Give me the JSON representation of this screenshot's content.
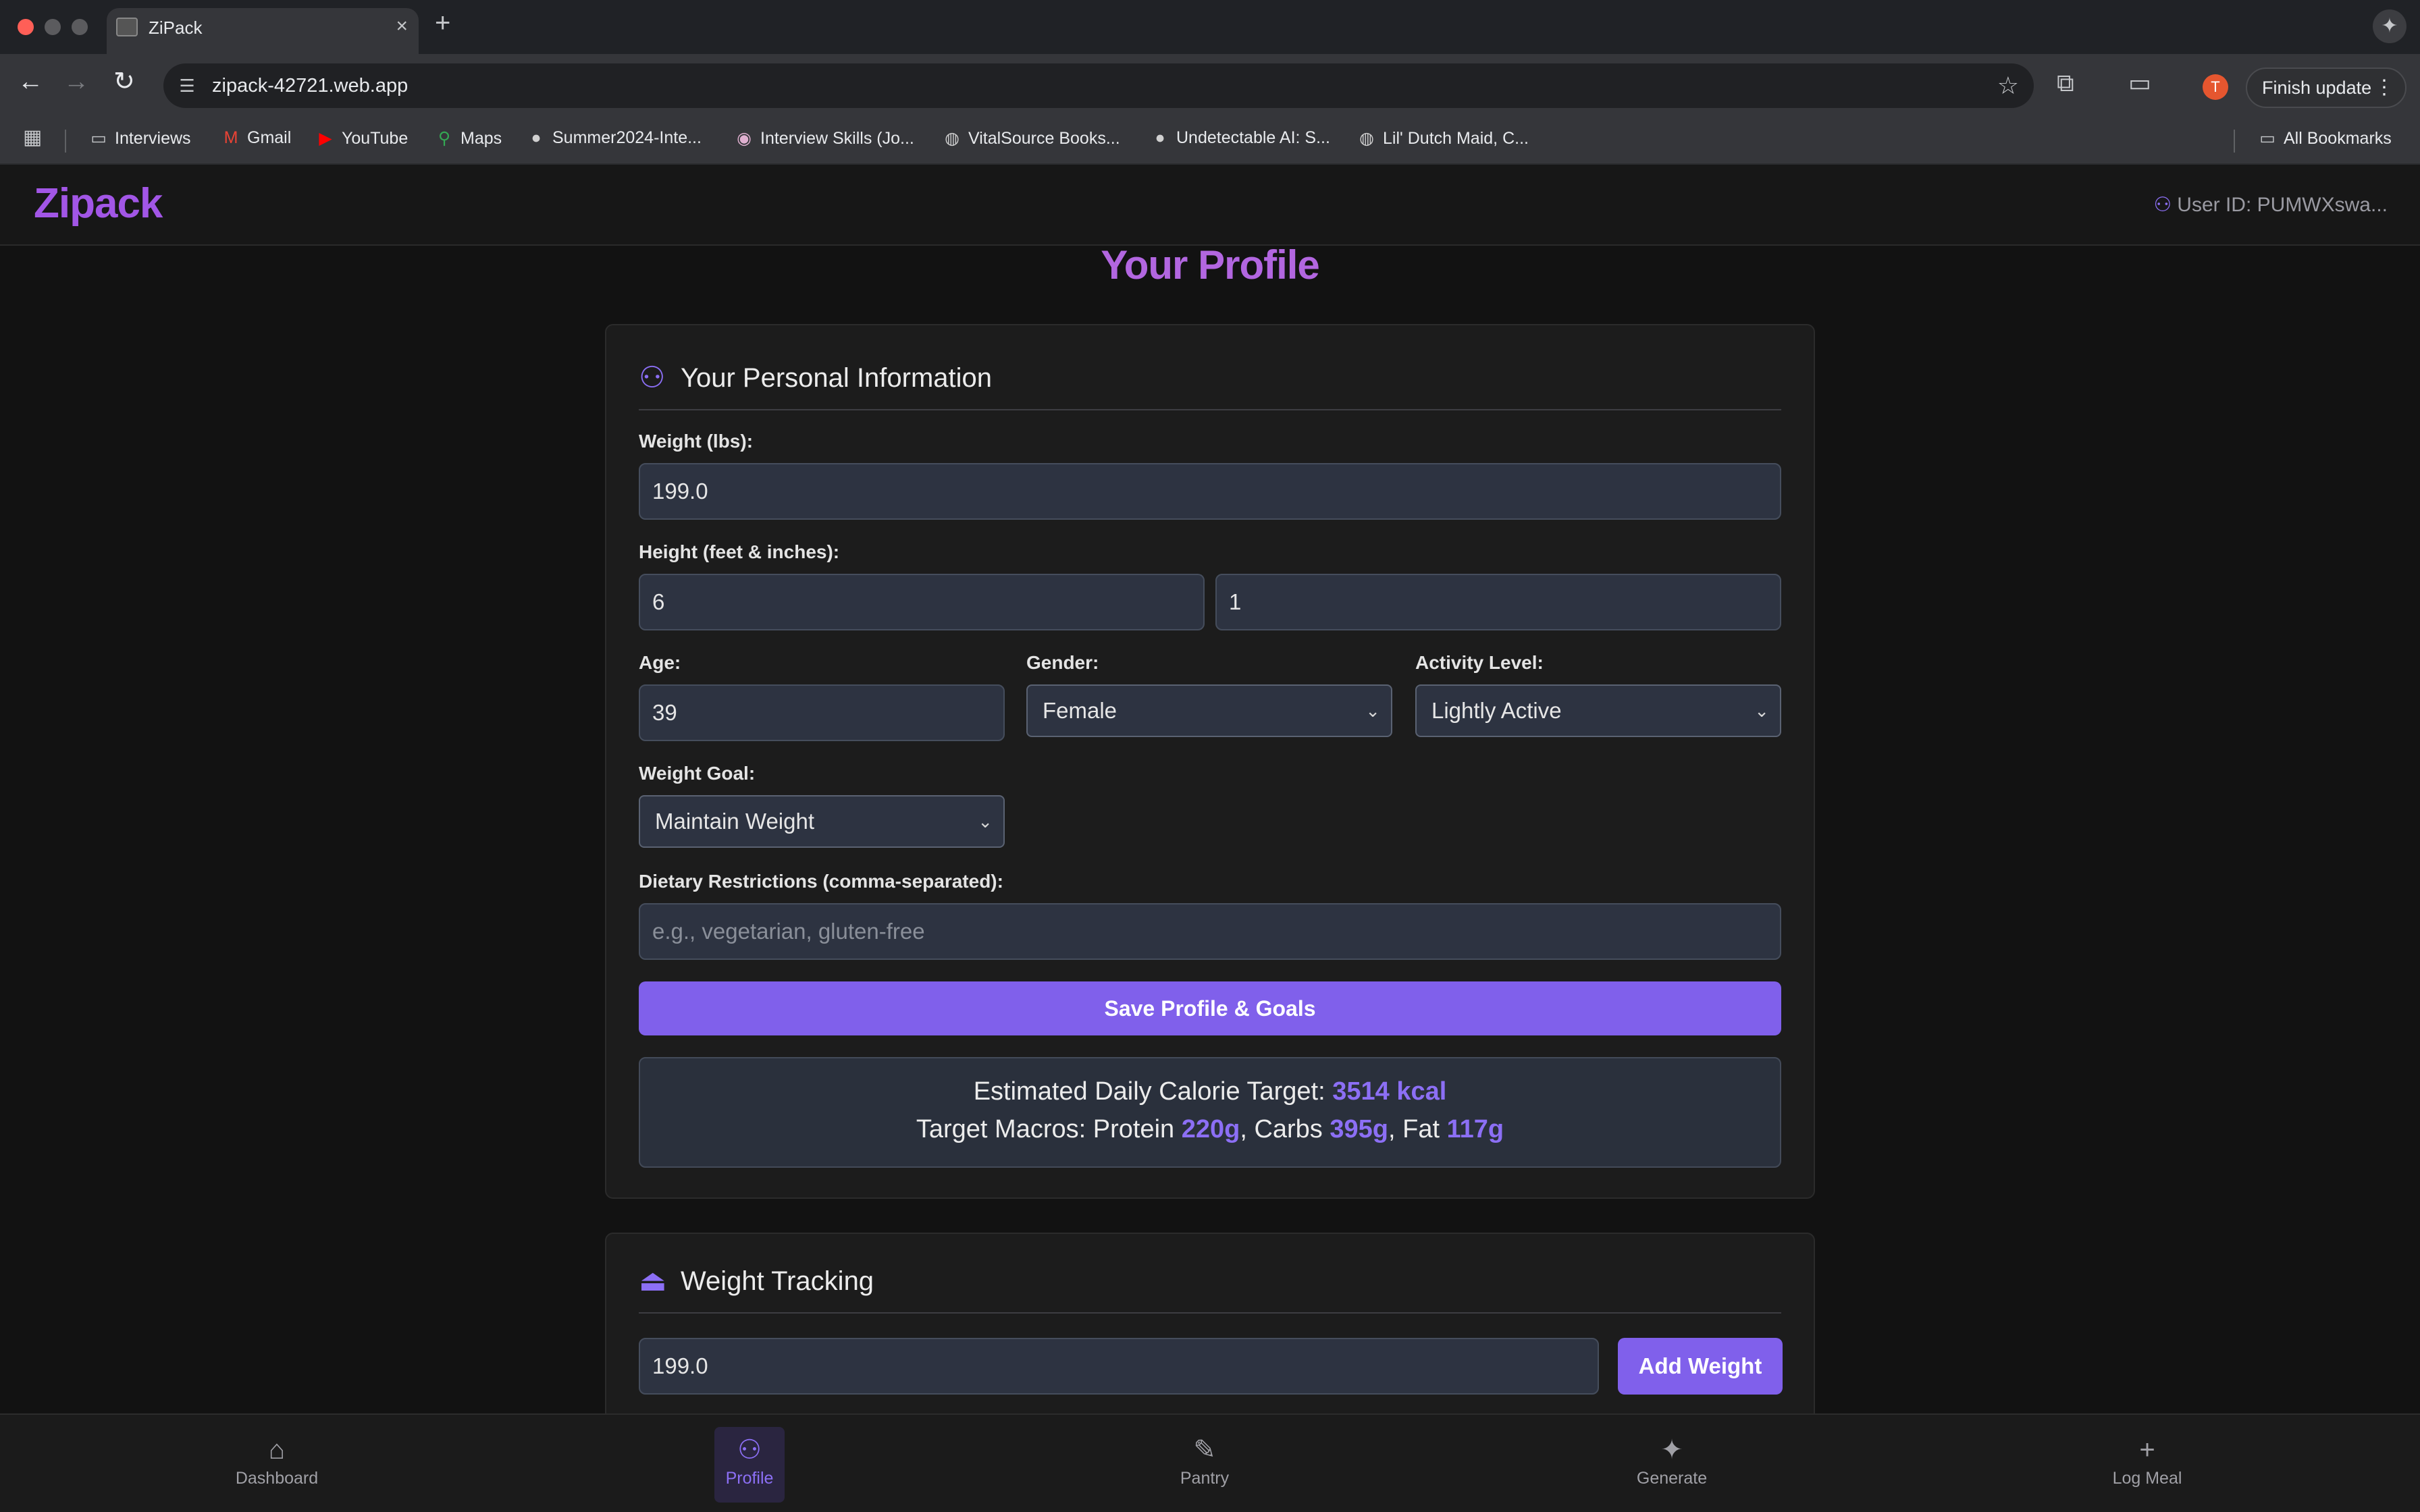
{
  "browser": {
    "tab_title": "ZiPack",
    "tab_close": "×",
    "new_tab": "+",
    "url": "zipack-42721.web.app",
    "avatar_letter": "T",
    "finish_update": "Finish update",
    "bookmarks": [
      {
        "label": "Interviews",
        "icon": "folder-icon"
      },
      {
        "label": "Gmail",
        "icon": "gmail-icon"
      },
      {
        "label": "YouTube",
        "icon": "youtube-icon"
      },
      {
        "label": "Maps",
        "icon": "maps-icon"
      },
      {
        "label": "Summer2024-Inte...",
        "icon": "github-icon"
      },
      {
        "label": "Interview Skills (Jo...",
        "icon": "site-icon"
      },
      {
        "label": "VitalSource Books...",
        "icon": "globe-icon"
      },
      {
        "label": "Undetectable AI: S...",
        "icon": "site-icon"
      },
      {
        "label": "Lil' Dutch Maid, C...",
        "icon": "globe-icon"
      }
    ],
    "all_bookmarks": "All Bookmarks"
  },
  "header": {
    "brand": "Zipack",
    "user_id": "User ID: PUMWXswa..."
  },
  "page_title": "Your Profile",
  "personal": {
    "title": "Your Personal Information",
    "weight_label": "Weight (lbs):",
    "weight_value": "199.0",
    "height_label": "Height (feet & inches):",
    "height_feet": "6",
    "height_inches": "1",
    "age_label": "Age:",
    "age_value": "39",
    "gender_label": "Gender:",
    "gender_value": "Female",
    "activity_label": "Activity Level:",
    "activity_value": "Lightly Active",
    "goal_label": "Weight Goal:",
    "goal_value": "Maintain Weight",
    "dietary_label": "Dietary Restrictions (comma-separated):",
    "dietary_placeholder": "e.g., vegetarian, gluten-free",
    "save_label": "Save Profile & Goals"
  },
  "summary": {
    "calorie_prefix": "Estimated Daily Calorie Target: ",
    "calorie_value": "3514 kcal",
    "macros_prefix": "Target Macros: Protein ",
    "protein": "220g",
    "carbs_prefix": ", Carbs ",
    "carbs": "395g",
    "fat_prefix": ", Fat ",
    "fat": "117g"
  },
  "weight_tracking": {
    "title": "Weight Tracking",
    "input_value": "199.0",
    "add_label": "Add Weight"
  },
  "bottom_nav": {
    "dashboard": "Dashboard",
    "profile": "Profile",
    "pantry": "Pantry",
    "generate": "Generate",
    "log_meal": "Log Meal"
  },
  "colors": {
    "accent": "#8060eb",
    "brand": "#a256e6",
    "background": "#121212"
  }
}
